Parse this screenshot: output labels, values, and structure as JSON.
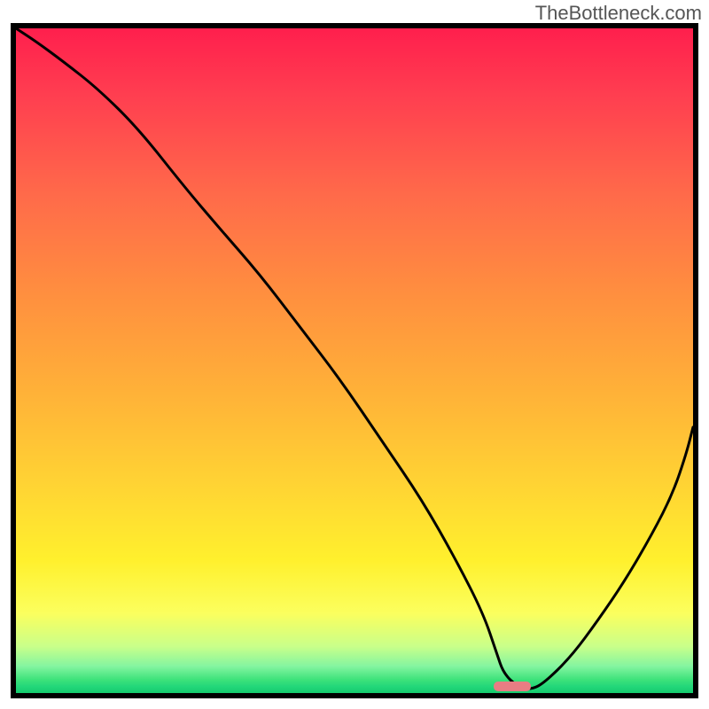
{
  "watermark": "TheBottleneck.com",
  "colors": {
    "border": "#000000",
    "curve": "#000000",
    "marker": "#e87d83"
  },
  "chart_data": {
    "type": "line",
    "title": "",
    "xlabel": "",
    "ylabel": "",
    "xlim": [
      0,
      100
    ],
    "ylim": [
      0,
      100
    ],
    "grid": false,
    "marker_range_x": [
      70.5,
      76
    ],
    "series": [
      {
        "name": "curve",
        "x": [
          0,
          3,
          7,
          12,
          18,
          25,
          30,
          36,
          42,
          48,
          54,
          60,
          65,
          69,
          71,
          72,
          74,
          76,
          78,
          82,
          86,
          90,
          94,
          97,
          99,
          100
        ],
        "y": [
          100,
          98,
          95,
          91,
          85,
          76,
          70,
          63,
          55,
          47,
          38,
          29,
          20,
          12,
          6,
          3,
          1,
          0.5,
          1.5,
          5.5,
          11,
          17,
          24,
          30,
          36,
          40
        ]
      }
    ],
    "notes": "Axis has no tick labels in source image. x=0..100 left→right, y=0 at bottom border, y=100 at top border. Values estimated from pixel positions."
  }
}
